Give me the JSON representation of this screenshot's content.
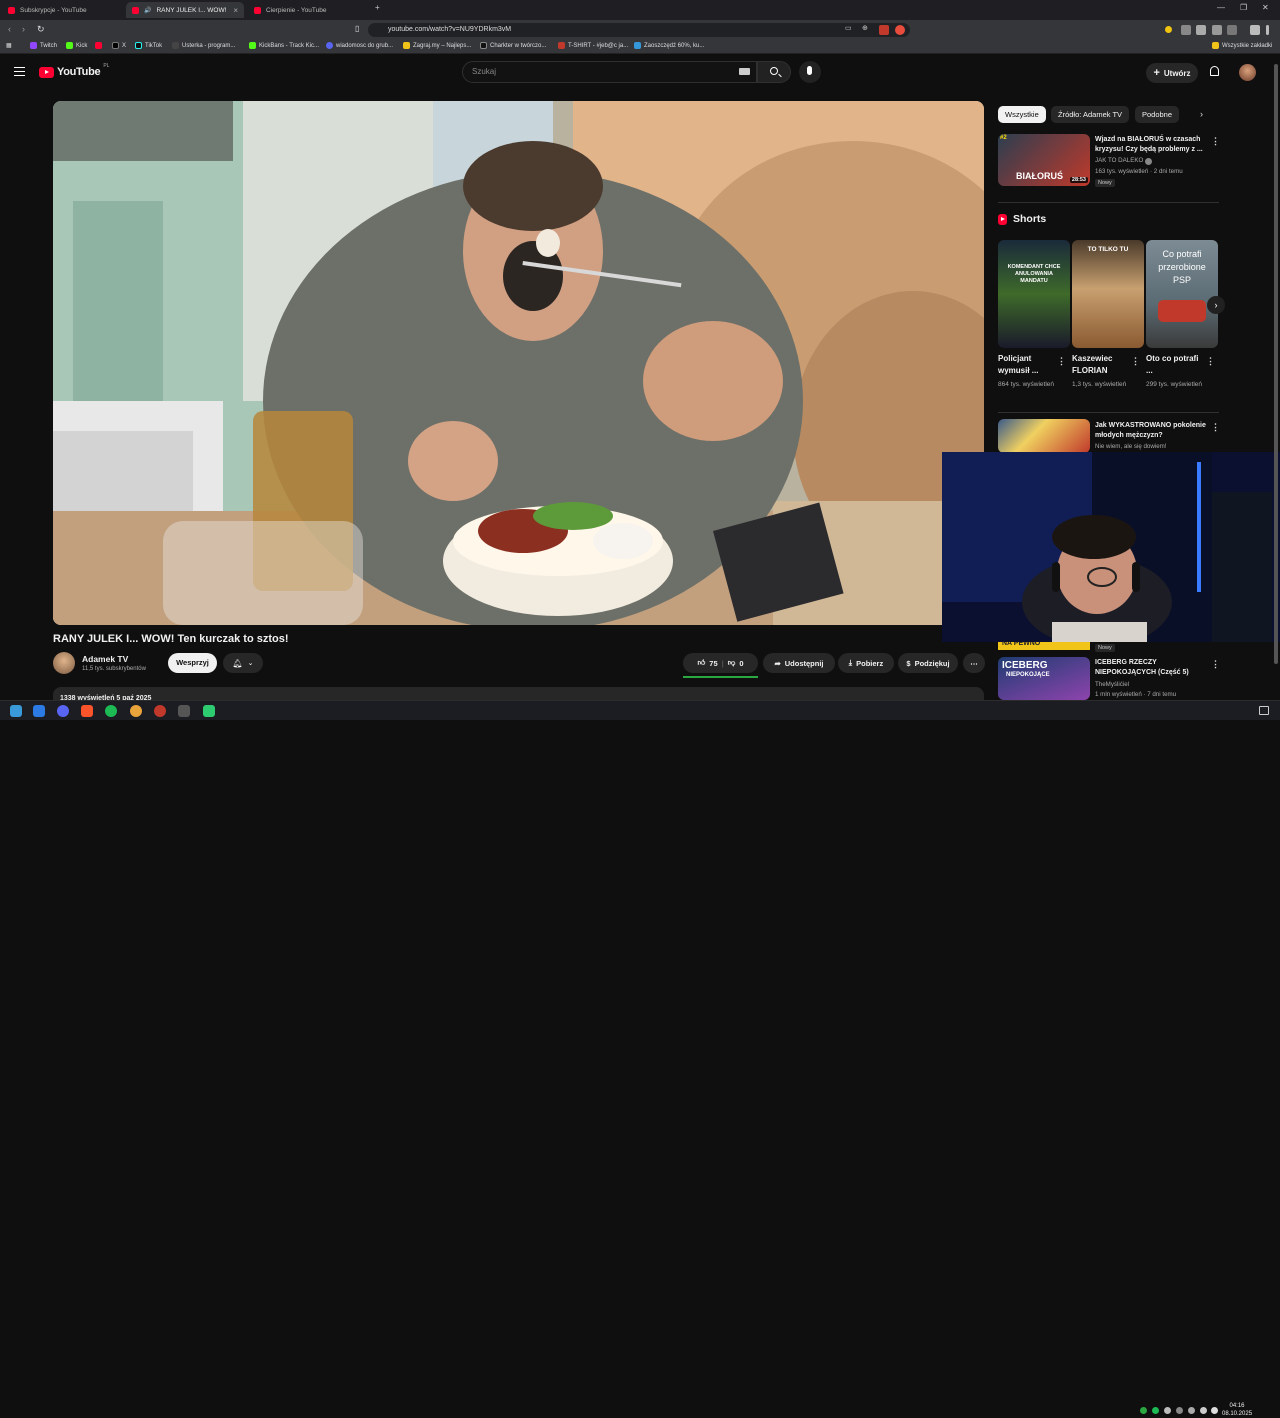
{
  "browser": {
    "tabs": [
      {
        "title": "Subskrypcje - YouTube",
        "active": false
      },
      {
        "title": "RANY JULEK I... WOW! Ten ku",
        "active": true
      },
      {
        "title": "Cierpienie - YouTube",
        "active": false
      }
    ],
    "new_tab": "+",
    "url": "youtube.com/watch?v=NU9YDRkm3vM",
    "bookmarks": [
      "Twitch",
      "Kick",
      "X",
      "TikTok",
      "Usterka - program...",
      "KickBans - Track Kic...",
      "wiadomosc do grub...",
      "Zagraj.my – Najleps...",
      "Charkter w twórczo...",
      "T-SHIRT - #jeb@c ja...",
      "Zaoszczędź 60%, ku..."
    ],
    "all_bookmarks": "Wszystkie zakładki"
  },
  "header": {
    "logo": "YouTube",
    "region": "PL",
    "search_placeholder": "Szukaj",
    "create_label": "Utwórz"
  },
  "video": {
    "title": "RANY JULEK I... WOW! Ten kurczak to sztos!",
    "channel": "Adamek TV",
    "subscribers": "11,5 tys. subskrybentów",
    "join_label": "Wesprzyj",
    "likes": "75",
    "dislikes": "0",
    "share_label": "Udostępnij",
    "download_label": "Pobierz",
    "thanks_label": "Podziękuj",
    "more": "⋯",
    "description_meta": "1338 wyświetleń  5 paź 2025"
  },
  "sidebar": {
    "chips": [
      "Wszystkie",
      "Źródło: Adamek TV",
      "Podobne"
    ],
    "videos": [
      {
        "title": "Wjazd na BIAŁORUŚ w czasach kryzysu! Czy będą problemy z ...",
        "channel": "JAK TO DALEKO",
        "meta": "163 tys. wyświetleń · 2 dni temu",
        "badge": "Nowy",
        "duration": "28:53",
        "thumb_text": "BIAŁORUŚ",
        "rank": "#2"
      },
      {
        "title": "Jak WYKASTROWANO pokolenie młodych mężczyzn?",
        "channel": "Nie wiem, ale się dowiem!",
        "meta": "",
        "badge": ""
      },
      {
        "title": "ICEBERG RZECZY NIEPOKOJĄCYCH (Część 5)",
        "channel": "TheMyślićiel",
        "meta": "1 mln wyświetleń · 7 dni temu",
        "badge": "",
        "thumb_text": "ICEBERG",
        "thumb_sub": "NIEPOKOJĄCE"
      }
    ],
    "shorts_heading": "Shorts",
    "shorts": [
      {
        "title": "Policjant wymusił ...",
        "views": "864 tys. wyświetleń",
        "thumb_text": "KOMENDANT CHCE ANULOWANIA MANDATU"
      },
      {
        "title": "Kaszewiec FLORIAN",
        "views": "1,3 tys. wyświetleń",
        "thumb_text": "TO TILKO TU"
      },
      {
        "title": "Oto co potrafi ...",
        "views": "299 tys. wyświetleń",
        "thumb_text": "Co potrafi przerobione PSP"
      }
    ],
    "partial_badge": "Nowy",
    "partial_thumb_text": "NA PEWNO",
    "kebab": "⋮"
  },
  "taskbar": {
    "time": "04:16",
    "date": "08.10.2025"
  },
  "colors": {
    "accent": "#ff0033",
    "bg": "#0f0f0f",
    "chip": "#272727",
    "like_bar": "#2ba640"
  }
}
